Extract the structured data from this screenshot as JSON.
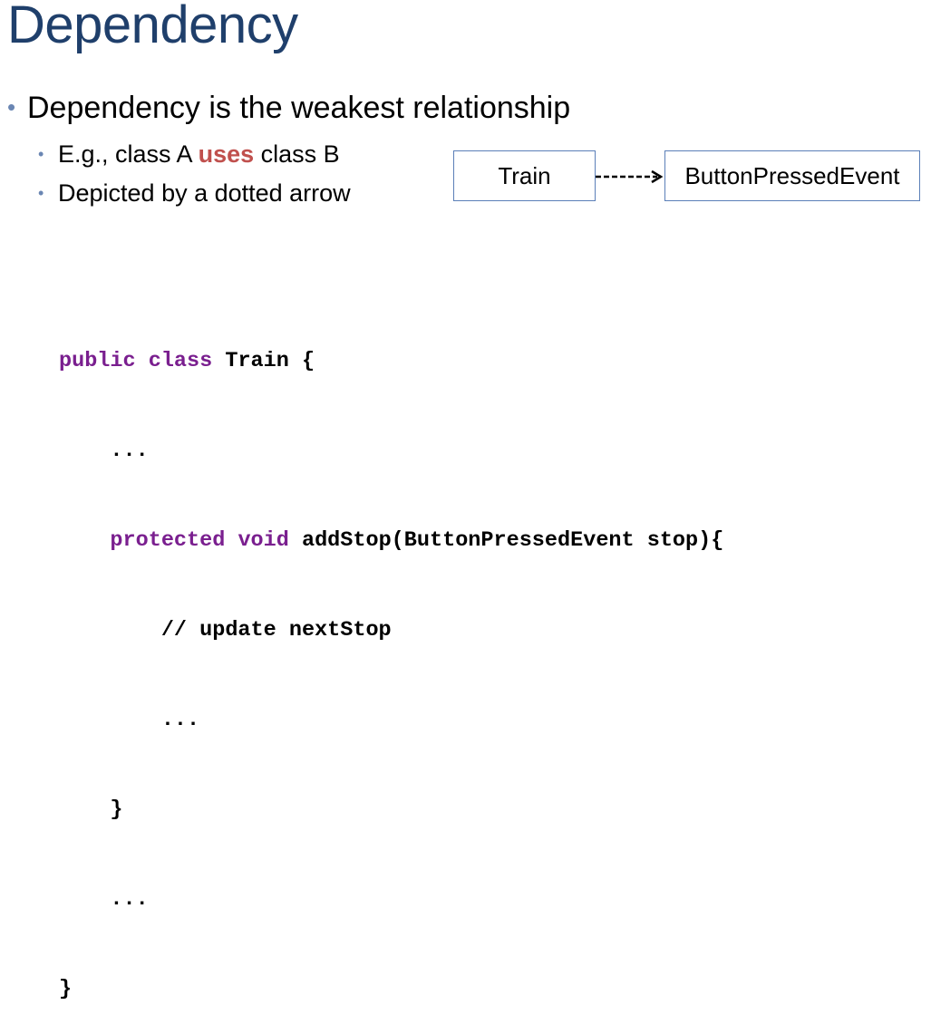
{
  "title": "Dependency",
  "bullets": {
    "main": "Dependency is the weakest relationship",
    "sub1_prefix": "E.g., class A ",
    "sub1_emph": "uses",
    "sub1_suffix": " class B",
    "sub2": "Depicted by a dotted arrow",
    "dot": "•"
  },
  "diagram": {
    "source_class": "Train",
    "target_class": "ButtonPressedEvent",
    "relationship": "dependency",
    "arrow_style": "dashed"
  },
  "code": {
    "l1_kw": "public class",
    "l1_rest": " Train {",
    "l2": "    ...",
    "l3_indent": "    ",
    "l3_kw": "protected void",
    "l3_rest": " addStop(ButtonPressedEvent stop){",
    "l4": "        // update nextStop",
    "l5": "        ...",
    "l6": "    }",
    "l7": "    ...",
    "l8": "}"
  },
  "colors": {
    "title": "#1f3f6b",
    "bullet_dot": "#6a86b3",
    "emphasis": "#c0504d",
    "keyword": "#7a1f8f",
    "box_border": "#5b7fb8"
  }
}
